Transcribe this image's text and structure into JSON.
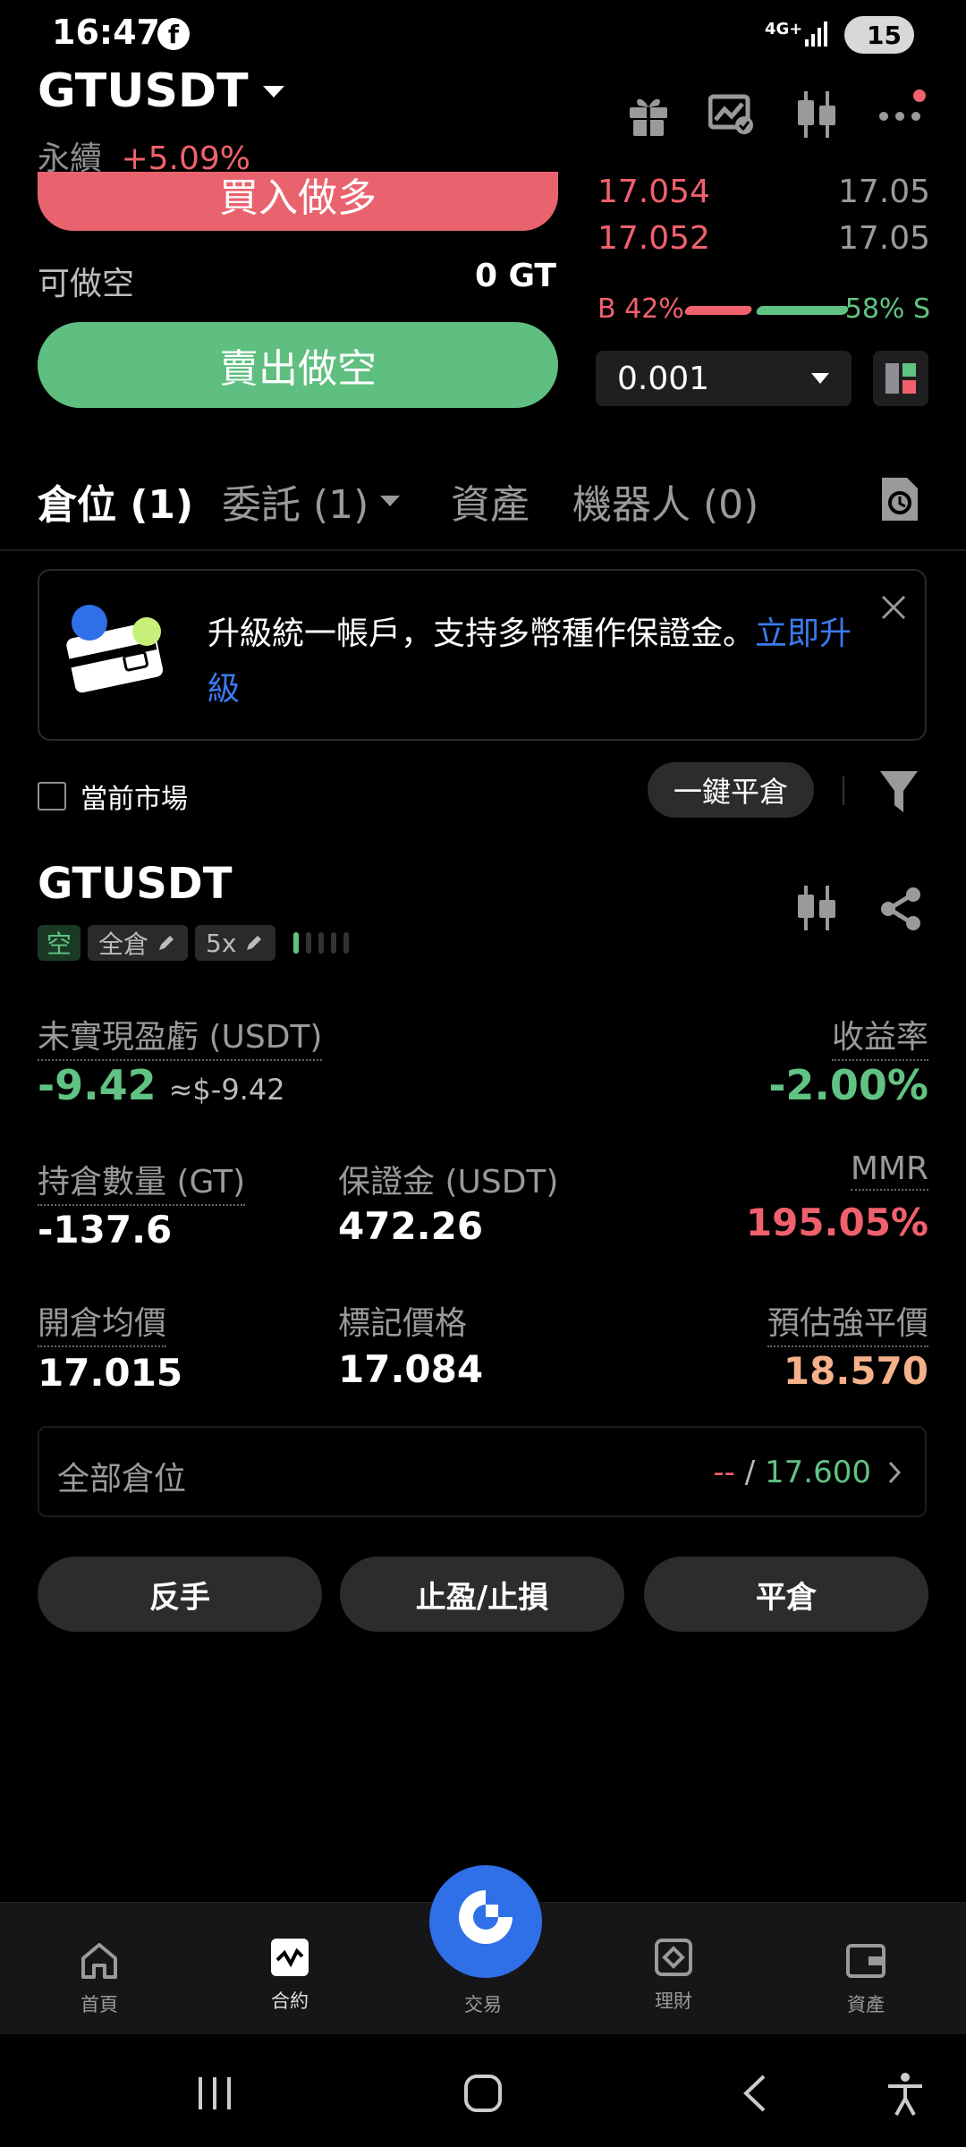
{
  "status": {
    "time": "16:47",
    "network": "4G+",
    "battery": "15"
  },
  "header": {
    "symbol": "GTUSDT",
    "type": "永續",
    "change": "+5.09%"
  },
  "trade": {
    "buy_label": "買入做多",
    "short_avail_label": "可做空",
    "short_avail_value": "0 GT",
    "sell_label": "賣出做空"
  },
  "orderbook": {
    "asks": [
      {
        "price": "17.054",
        "size": "17.05"
      },
      {
        "price": "17.052",
        "size": "17.05"
      }
    ],
    "buy_ratio": "B 42%",
    "sell_ratio": "58% S",
    "buy_ratio_value": 42,
    "precision": "0.001"
  },
  "tabs": {
    "positions": "倉位 (1)",
    "orders": "委託 (1)",
    "assets": "資產",
    "bots": "機器人 (0)"
  },
  "banner": {
    "text": "升級統一帳戶，支持多幣種作保證金。",
    "link": "立即升級"
  },
  "filter_bar": {
    "current_market": "當前市場",
    "close_all": "一鍵平倉"
  },
  "position": {
    "symbol": "GTUSDT",
    "side": "空",
    "margin_mode": "全倉",
    "leverage": "5x",
    "pnl_label": "未實現盈虧 (USDT)",
    "pnl_value": "-9.42",
    "pnl_approx": "≈$-9.42",
    "roe_label": "收益率",
    "roe_value": "-2.00%",
    "size_label": "持倉數量 (GT)",
    "size_value": "-137.6",
    "margin_label": "保證金 (USDT)",
    "margin_value": "472.26",
    "mmr_label": "MMR",
    "mmr_value": "195.05%",
    "entry_label": "開倉均價",
    "entry_value": "17.015",
    "mark_label": "標記價格",
    "mark_value": "17.084",
    "liq_label": "預估強平價",
    "liq_value": "18.570",
    "all_label": "全部倉位",
    "all_value_left": "--",
    "all_value_sep": " / ",
    "all_value_right": "17.600"
  },
  "actions": {
    "reverse": "反手",
    "tpsl": "止盈/止損",
    "close": "平倉"
  },
  "bottom_nav": {
    "home": "首頁",
    "futures": "合約",
    "trade": "交易",
    "earn": "理財",
    "assets": "資產"
  },
  "colors": {
    "red": "#f0616d",
    "green": "#61c383",
    "blue": "#2f6fe8",
    "orange": "#f4b18a"
  }
}
